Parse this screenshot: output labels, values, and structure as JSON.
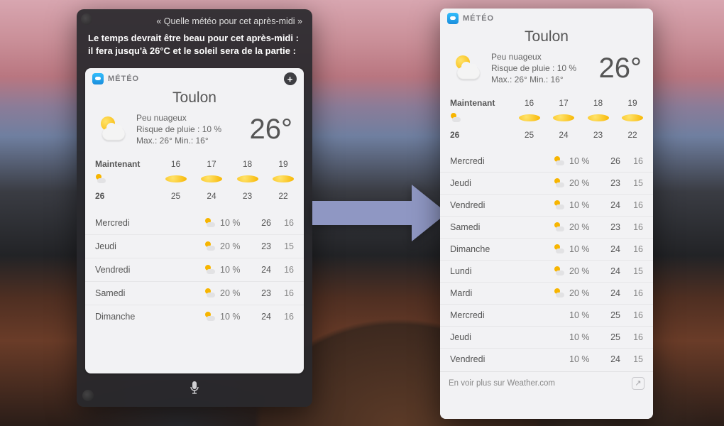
{
  "siri": {
    "query": "Quelle météo pour cet après-midi",
    "reply": "Le temps devrait être beau pour cet après-midi : il fera jusqu'à 26°C et le soleil sera de la partie :",
    "app_label": "MÉTÉO",
    "city": "Toulon",
    "condition": "Peu nuageux",
    "rain_line": "Risque de pluie : 10 %",
    "range_line": "Max.: 26°  Min.: 16°",
    "temp": "26°",
    "hour_labels": [
      "Maintenant",
      "16",
      "17",
      "18",
      "19"
    ],
    "hour_icons": [
      "pc",
      "sun",
      "sun",
      "sun",
      "sun"
    ],
    "hour_temps": [
      "26",
      "25",
      "24",
      "23",
      "22"
    ],
    "daily": [
      {
        "day": "Mercredi",
        "icon": "pc",
        "rain": "10 %",
        "hi": "26",
        "lo": "16"
      },
      {
        "day": "Jeudi",
        "icon": "pc",
        "rain": "20 %",
        "hi": "23",
        "lo": "15"
      },
      {
        "day": "Vendredi",
        "icon": "pc",
        "rain": "10 %",
        "hi": "24",
        "lo": "16"
      },
      {
        "day": "Samedi",
        "icon": "pc",
        "rain": "20 %",
        "hi": "23",
        "lo": "16"
      },
      {
        "day": "Dimanche",
        "icon": "pc",
        "rain": "10 %",
        "hi": "24",
        "lo": "16"
      }
    ]
  },
  "widget": {
    "app_label": "MÉTÉO",
    "city": "Toulon",
    "condition": "Peu nuageux",
    "rain_line": "Risque de pluie : 10 %",
    "range_line": "Max.: 26°  Min.: 16°",
    "temp": "26°",
    "hour_labels": [
      "Maintenant",
      "16",
      "17",
      "18",
      "19"
    ],
    "hour_icons": [
      "pc",
      "sun",
      "sun",
      "sun",
      "sun"
    ],
    "hour_temps": [
      "26",
      "25",
      "24",
      "23",
      "22"
    ],
    "daily": [
      {
        "day": "Mercredi",
        "icon": "pc",
        "rain": "10 %",
        "hi": "26",
        "lo": "16"
      },
      {
        "day": "Jeudi",
        "icon": "pc",
        "rain": "20 %",
        "hi": "23",
        "lo": "15"
      },
      {
        "day": "Vendredi",
        "icon": "pc",
        "rain": "10 %",
        "hi": "24",
        "lo": "16"
      },
      {
        "day": "Samedi",
        "icon": "pc",
        "rain": "20 %",
        "hi": "23",
        "lo": "16"
      },
      {
        "day": "Dimanche",
        "icon": "pc",
        "rain": "10 %",
        "hi": "24",
        "lo": "16"
      },
      {
        "day": "Lundi",
        "icon": "pc",
        "rain": "20 %",
        "hi": "24",
        "lo": "15"
      },
      {
        "day": "Mardi",
        "icon": "pc",
        "rain": "20 %",
        "hi": "24",
        "lo": "16"
      },
      {
        "day": "Mercredi",
        "icon": "sun",
        "rain": "10 %",
        "hi": "25",
        "lo": "16"
      },
      {
        "day": "Jeudi",
        "icon": "sun",
        "rain": "10 %",
        "hi": "25",
        "lo": "16"
      },
      {
        "day": "Vendredi",
        "icon": "sun",
        "rain": "10 %",
        "hi": "24",
        "lo": "15"
      }
    ],
    "footer": "En voir plus sur Weather.com"
  }
}
